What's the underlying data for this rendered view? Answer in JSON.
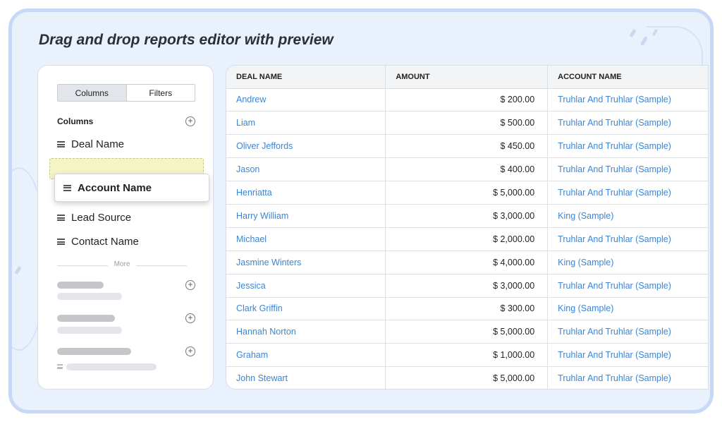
{
  "title": "Drag and drop reports editor with preview",
  "panel": {
    "tabs": [
      {
        "label": "Columns",
        "active": true
      },
      {
        "label": "Filters",
        "active": false
      }
    ],
    "section_label": "Columns",
    "items": [
      "Deal Name",
      "Lead Source",
      "Contact Name"
    ],
    "dragging_item": "Account Name",
    "more_label": "More"
  },
  "table": {
    "columns": [
      "DEAL NAME",
      "AMOUNT",
      "ACCOUNT NAME"
    ],
    "rows": [
      [
        "Andrew",
        "$ 200.00",
        "Truhlar And Truhlar (Sample)"
      ],
      [
        "Liam",
        "$ 500.00",
        "Truhlar And Truhlar (Sample)"
      ],
      [
        "Oliver Jeffords",
        "$ 450.00",
        "Truhlar And Truhlar (Sample)"
      ],
      [
        "Jason",
        "$ 400.00",
        "Truhlar And Truhlar (Sample)"
      ],
      [
        "Henriatta",
        "$ 5,000.00",
        "Truhlar And Truhlar (Sample)"
      ],
      [
        "Harry William",
        "$ 3,000.00",
        "King (Sample)"
      ],
      [
        "Michael",
        "$ 2,000.00",
        "Truhlar And Truhlar (Sample)"
      ],
      [
        "Jasmine Winters",
        "$ 4,000.00",
        "King (Sample)"
      ],
      [
        "Jessica",
        "$ 3,000.00",
        "Truhlar And Truhlar (Sample)"
      ],
      [
        "Clark Griffin",
        "$ 300.00",
        "King (Sample)"
      ],
      [
        "Hannah Norton",
        "$ 5,000.00",
        "Truhlar And Truhlar (Sample)"
      ],
      [
        "Graham",
        "$ 1,000.00",
        "Truhlar And Truhlar (Sample)"
      ],
      [
        "John Stewart",
        "$ 5,000.00",
        "Truhlar And Truhlar (Sample)"
      ]
    ]
  },
  "colors": {
    "link": "#3b86d6",
    "frame_border": "#c7d9f7",
    "frame_bg": "#e9f1fc",
    "dropzone": "#f4f4c6"
  }
}
